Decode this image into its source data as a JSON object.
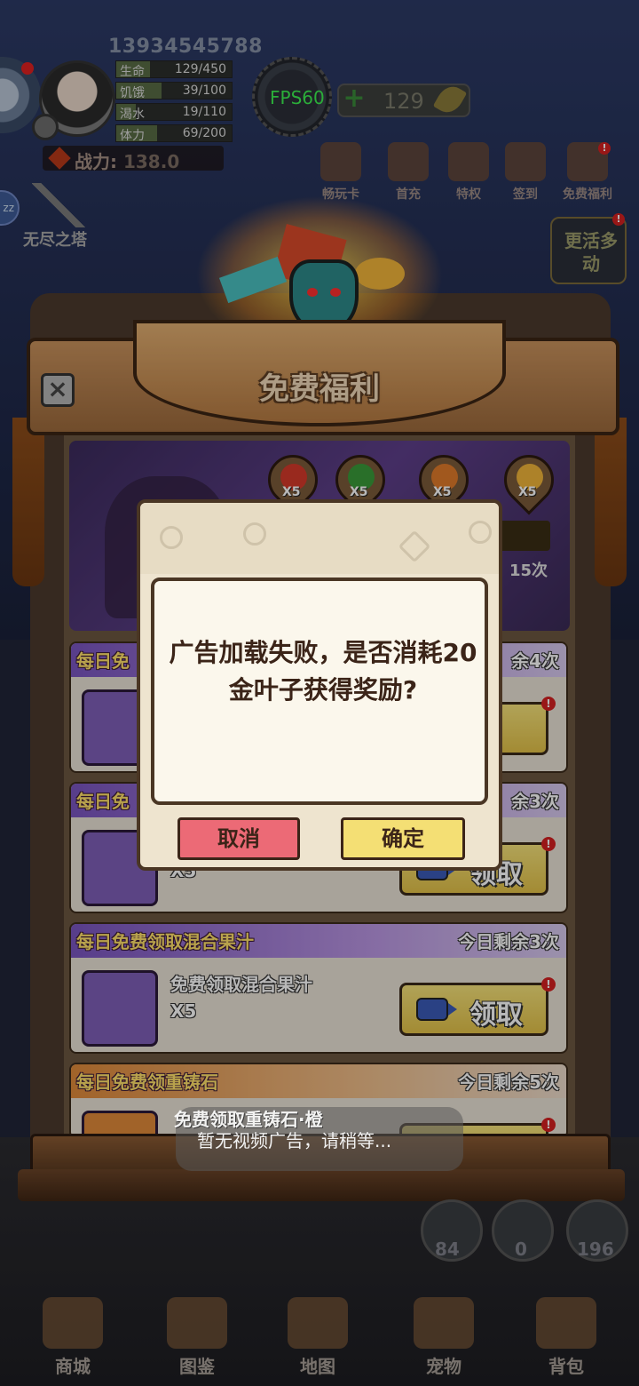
{
  "hud": {
    "user_id": "13934545788",
    "stats": [
      {
        "label": "生命",
        "value": "129/450",
        "fill": 0.29
      },
      {
        "label": "饥饿",
        "value": "39/100",
        "fill": 0.39
      },
      {
        "label": "渴水",
        "value": "19/110",
        "fill": 0.17
      },
      {
        "label": "体力",
        "value": "69/200",
        "fill": 0.35
      }
    ],
    "power_label": "战力:",
    "power_value": "138.0",
    "fps": "FPS60",
    "gold_leaf": "129",
    "top_icons": [
      "畅玩卡",
      "首充",
      "特权",
      "签到",
      "免费福利"
    ],
    "tower": "无尽之塔",
    "active": "更活多动"
  },
  "panel": {
    "title": "免费福利",
    "food_rewards": [
      {
        "icon": "apple-icon",
        "qty": "X5",
        "color": "#d43a2a"
      },
      {
        "icon": "watermelon-icon",
        "qty": "X5",
        "color": "#3a9a3a"
      },
      {
        "icon": "bottle-icon",
        "qty": "X5",
        "color": "#e07a2a"
      },
      {
        "icon": "gold-leaf-icon",
        "qty": "X5",
        "color": "#f0b43a"
      }
    ],
    "banner_count": "15次",
    "rows": [
      {
        "title": "每日免",
        "remain": "余4次",
        "claim": "取",
        "name": "",
        "qty": ""
      },
      {
        "title": "每日免",
        "remain": "余3次",
        "claim": "领取",
        "name": "",
        "qty": "X5"
      },
      {
        "title": "每日免费领取混合果汁",
        "remain": "今日剩余3次",
        "claim": "领取",
        "name": "免费领取混合果汁",
        "qty": "X5"
      },
      {
        "title": "每日免费领重铸石",
        "remain": "今日剩余5次",
        "claim": "",
        "name": "免费领取重铸石·橙",
        "qty": ""
      }
    ]
  },
  "dialog": {
    "message": "广告加载失败，是否消耗20金叶子获得奖励?",
    "cancel": "取消",
    "confirm": "确定"
  },
  "toast": "暂无视频广告，请稍等...",
  "resources": [
    {
      "icon": "apple-icon",
      "value": "84"
    },
    {
      "icon": "bottle-icon",
      "value": "0"
    },
    {
      "icon": "carrot-icon",
      "value": "196"
    }
  ],
  "nav": [
    "商城",
    "图鉴",
    "地图",
    "宠物",
    "背包"
  ]
}
